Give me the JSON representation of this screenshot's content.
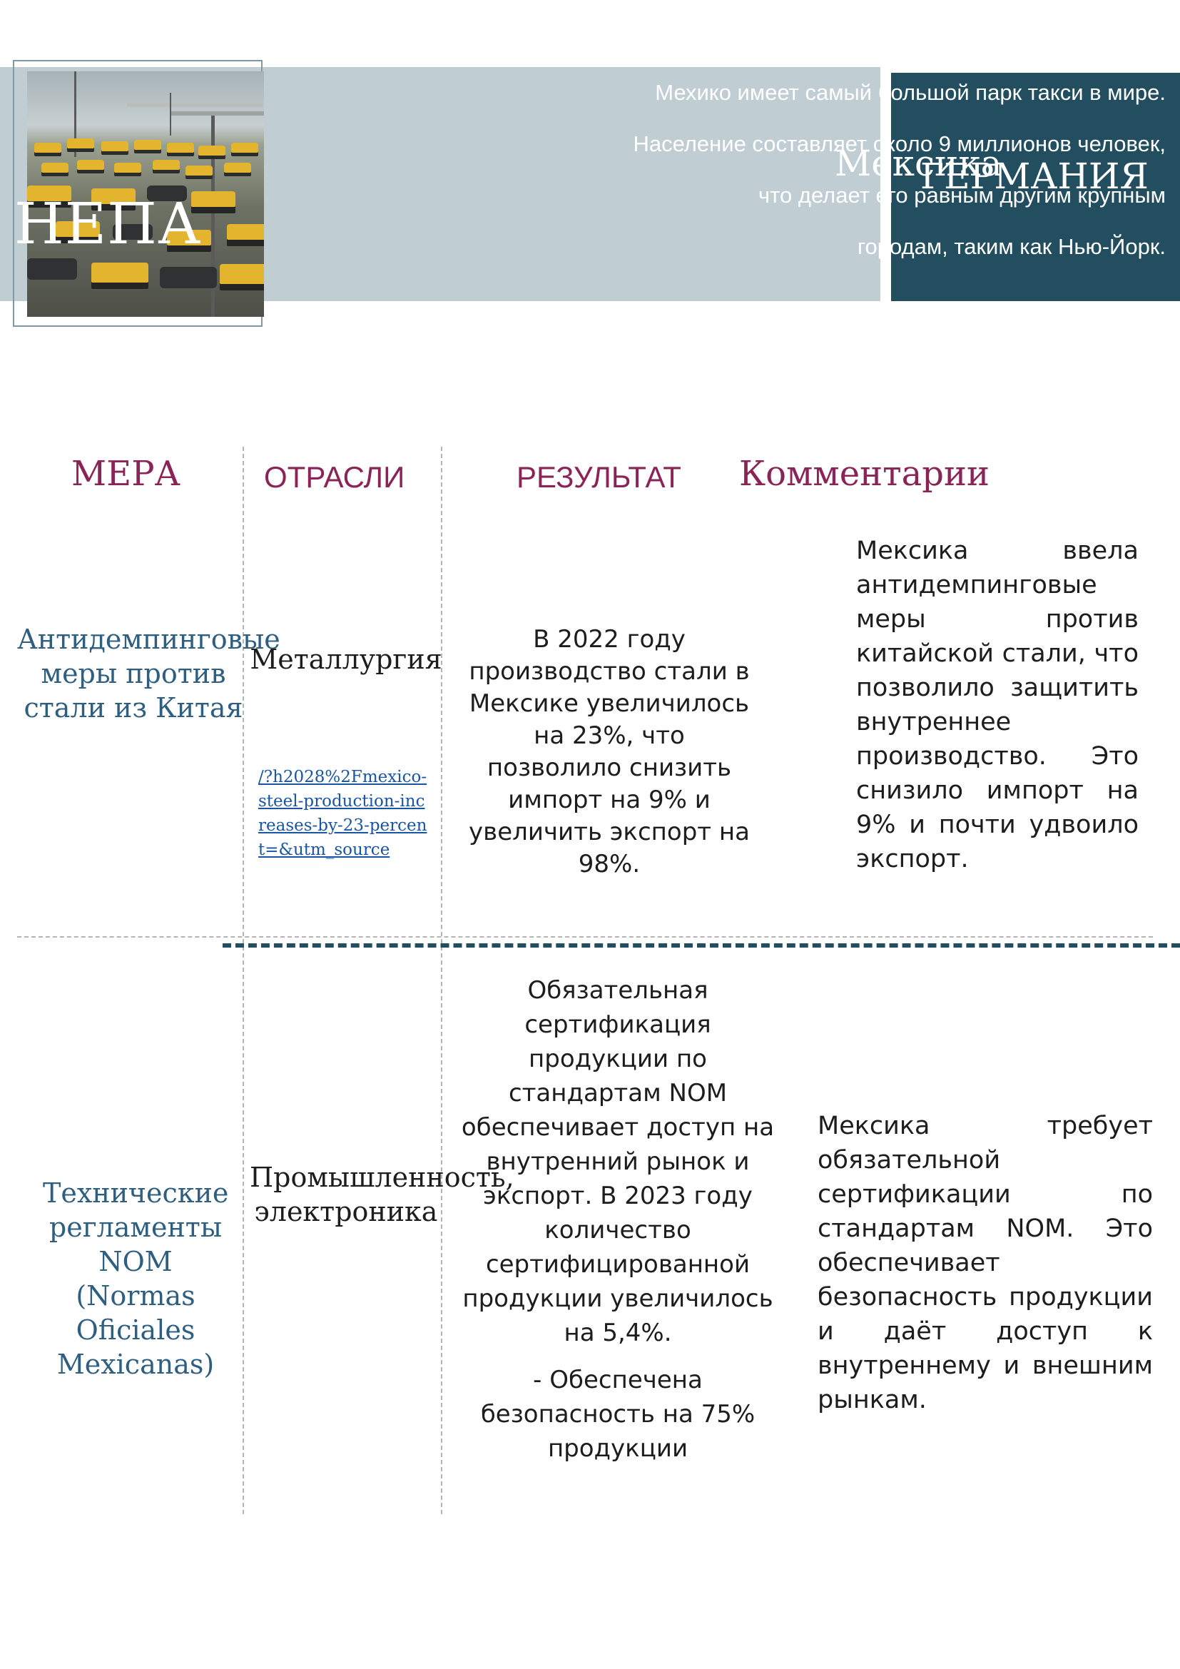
{
  "header": {
    "region_label": "НЕПА",
    "country_1": "Мексика",
    "country_2": "ГЕРМАНИЯ",
    "intro_lines": [
      "Мехико имеет самый большой парк такси в мире.",
      "Население составляет около 9 миллионов человек,",
      "что делает его равным другим крупным",
      "городам, таким как Нью-Йорк."
    ],
    "photo": "taxi-fleet-photo"
  },
  "table": {
    "headers": {
      "measure": "МЕРА",
      "sectors": "ОТРАСЛИ",
      "result": "РЕЗУЛЬТАТ",
      "comments": "Комментарии"
    },
    "rows": [
      {
        "measure": "Антидемпинговые меры против стали из Китая",
        "sector": "Металлургия",
        "link": "/?h2028%2Fmexico-steel-production-increases-by-23-percent=&utm_source",
        "result": "В 2022 году производство стали в Мексике увеличилось на 23%, что позволило снизить импорт на 9% и увеличить экспорт на 98%.",
        "comment": "Мексика ввела антидемпинговые меры против китайской стали, что позволило защитить внутреннее производство. Это снизило импорт на 9% и почти удвоило экспорт."
      },
      {
        "measure": "Технические регламенты NOM (Normas Oficiales Mexicanas)",
        "sector": "Промышленность, электроника",
        "result_paragraphs": [
          "Обязательная сертификация продукции по стандартам NOM обеспечивает доступ на внутренний рынок и экспорт. В 2023 году количество сертифицированной продукции увеличилось на 5,4%.",
          "- Обеспечена безопасность на 75% продукции"
        ],
        "comment": "Мексика требует обязательной сертификации по стандартам NOM. Это обеспечивает безопасность продукции и даёт доступ к внутреннему и внешним рынкам."
      }
    ]
  }
}
